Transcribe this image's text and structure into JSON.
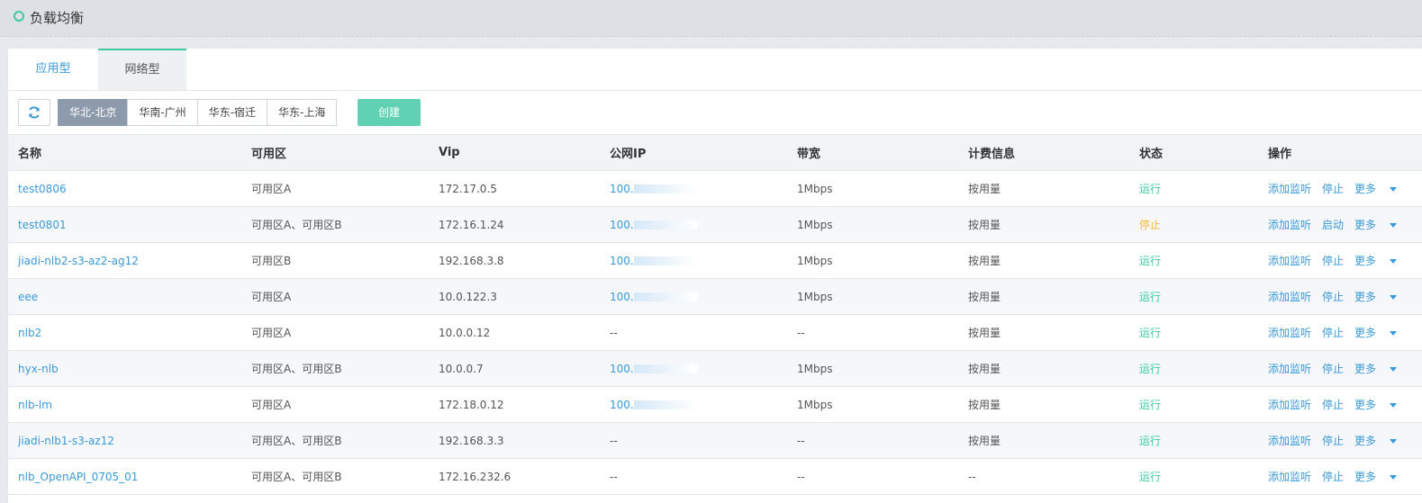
{
  "header": {
    "title": "负载均衡"
  },
  "tabs": [
    {
      "label": "应用型"
    },
    {
      "label": "网络型"
    }
  ],
  "toolbar": {
    "regions": [
      "华北-北京",
      "华南-广州",
      "华东-宿迁",
      "华东-上海"
    ],
    "active_region": "华北-北京",
    "create_label": "创建"
  },
  "table": {
    "headers": [
      "名称",
      "可用区",
      "Vip",
      "公网IP",
      "带宽",
      "计费信息",
      "状态",
      "操作"
    ],
    "rows": [
      {
        "name": "test0806",
        "az": "可用区A",
        "vip": "172.17.0.5",
        "ip": "100.",
        "bw": "1Mbps",
        "billing": "按用量",
        "status": "运行",
        "op2": "停止"
      },
      {
        "name": "test0801",
        "az": "可用区A、可用区B",
        "vip": "172.16.1.24",
        "ip": "100.",
        "bw": "1Mbps",
        "billing": "按用量",
        "status": "停止",
        "op2": "启动"
      },
      {
        "name": "jiadi-nlb2-s3-az2-ag12",
        "az": "可用区B",
        "vip": "192.168.3.8",
        "ip": "100.",
        "bw": "1Mbps",
        "billing": "按用量",
        "status": "运行",
        "op2": "停止"
      },
      {
        "name": "eee",
        "az": "可用区A",
        "vip": "10.0.122.3",
        "ip": "100.",
        "bw": "1Mbps",
        "billing": "按用量",
        "status": "运行",
        "op2": "停止"
      },
      {
        "name": "nlb2",
        "az": "可用区A",
        "vip": "10.0.0.12",
        "ip": "--",
        "bw": "--",
        "billing": "按用量",
        "status": "运行",
        "op2": "停止"
      },
      {
        "name": "hyx-nlb",
        "az": "可用区A、可用区B",
        "vip": "10.0.0.7",
        "ip": "100.",
        "bw": "1Mbps",
        "billing": "按用量",
        "status": "运行",
        "op2": "停止"
      },
      {
        "name": "nlb-lm",
        "az": "可用区A",
        "vip": "172.18.0.12",
        "ip": "100.",
        "bw": "1Mbps",
        "billing": "按用量",
        "status": "运行",
        "op2": "停止"
      },
      {
        "name": "jiadi-nlb1-s3-az12",
        "az": "可用区A、可用区B",
        "vip": "192.168.3.3",
        "ip": "--",
        "bw": "--",
        "billing": "按用量",
        "status": "运行",
        "op2": "停止"
      },
      {
        "name": "nlb_OpenAPI_0705_01",
        "az": "可用区A、可用区B",
        "vip": "172.16.232.6",
        "ip": "--",
        "bw": "--",
        "billing": "--",
        "status": "运行",
        "op2": "停止"
      }
    ],
    "op_add_listener": "添加监听",
    "op_more": "更多"
  },
  "colors": {
    "accent": "#3fc9a2",
    "link": "#3a9ad9",
    "stopped": "#f6b93b"
  }
}
